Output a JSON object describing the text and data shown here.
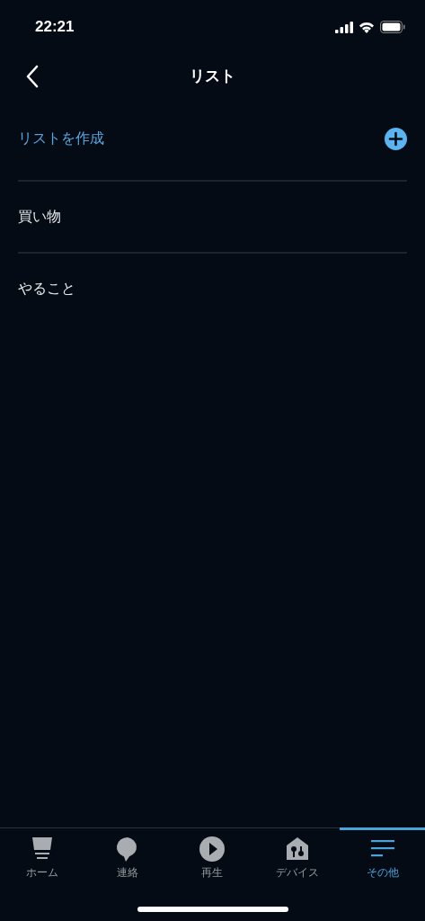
{
  "status_bar": {
    "time": "22:21"
  },
  "header": {
    "title": "リスト"
  },
  "create_row": {
    "label": "リストを作成"
  },
  "lists": [
    {
      "name": "買い物"
    },
    {
      "name": "やること"
    }
  ],
  "tab_bar": [
    {
      "label": "ホーム",
      "kind": "home",
      "selected": false
    },
    {
      "label": "連絡",
      "kind": "chat",
      "selected": false
    },
    {
      "label": "再生",
      "kind": "play",
      "selected": false
    },
    {
      "label": "デバイス",
      "kind": "devices",
      "selected": false
    },
    {
      "label": "その他",
      "kind": "more",
      "selected": true
    }
  ]
}
